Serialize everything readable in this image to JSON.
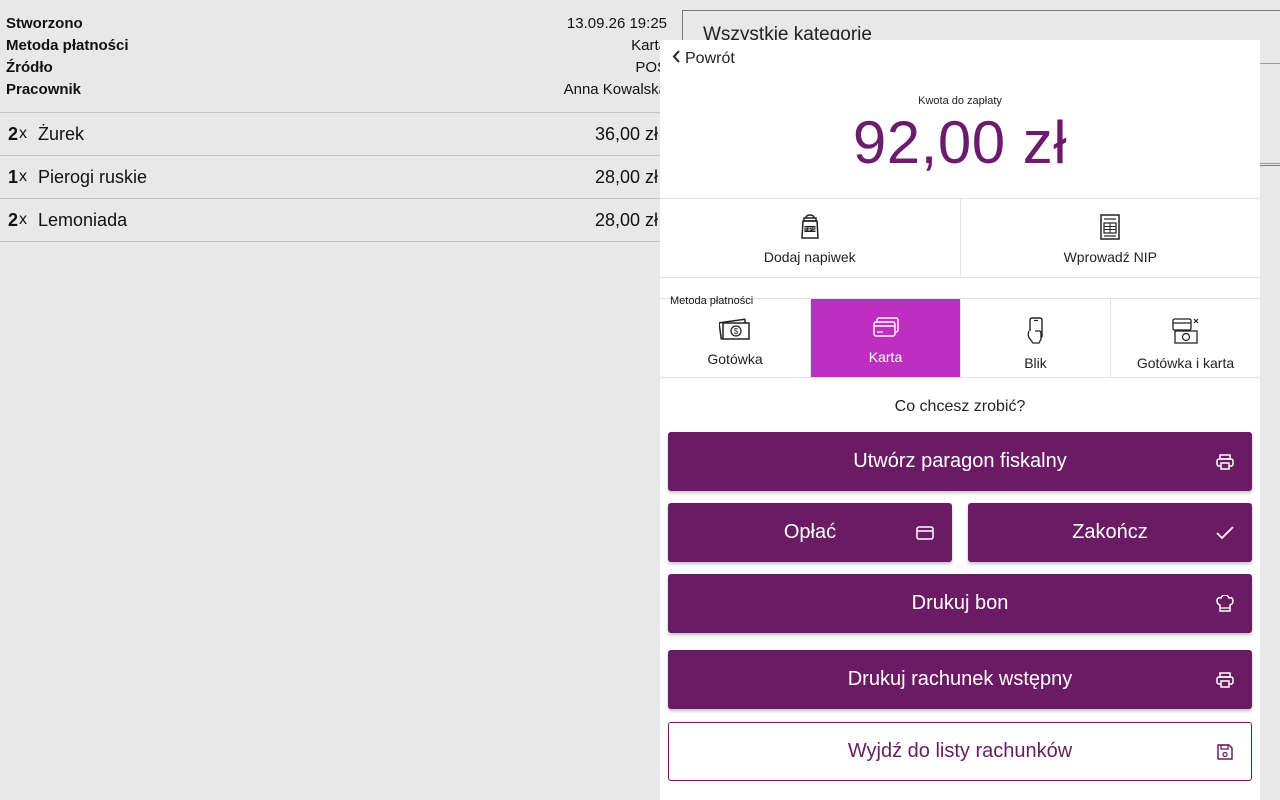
{
  "order": {
    "meta": [
      {
        "label": "Stworzono",
        "value": "13.09.26 19:25"
      },
      {
        "label": "Metoda płatności",
        "value": "Karta"
      },
      {
        "label": "Źródło",
        "value": "POS"
      },
      {
        "label": "Pracownik",
        "value": "Anna Kowalska"
      }
    ],
    "items": [
      {
        "qty": "2",
        "x": "x",
        "name": "Żurek",
        "price": "36,00 zł"
      },
      {
        "qty": "1",
        "x": "x",
        "name": "Pierogi ruskie",
        "price": "28,00 zł"
      },
      {
        "qty": "2",
        "x": "x",
        "name": "Lemoniada",
        "price": "28,00 zł"
      }
    ]
  },
  "categories": {
    "title": "Wszystkie kategorie"
  },
  "modal": {
    "back_label": "Powrót",
    "amount_label": "Kwota do zapłaty",
    "amount": "92,00 zł",
    "actions": [
      {
        "label": "Dodaj napiwek",
        "icon": "tips-jar-icon"
      },
      {
        "label": "Wprowadź NIP",
        "icon": "invoice-icon"
      }
    ],
    "payment_method_label": "Metoda płatności",
    "payment_methods": [
      {
        "label": "Gotówka",
        "icon": "cash-icon",
        "active": false
      },
      {
        "label": "Karta",
        "icon": "card-icon",
        "active": true
      },
      {
        "label": "Blik",
        "icon": "phone-icon",
        "active": false
      },
      {
        "label": "Gotówka i karta",
        "icon": "cash-and-card-icon",
        "active": false
      }
    ],
    "question": "Co chcesz zrobić?",
    "buttons": {
      "fiscal_receipt": "Utwórz paragon fiskalny",
      "pay": "Opłać",
      "finish": "Zakończ",
      "print_ticket": "Drukuj bon",
      "print_prebill": "Drukuj rachunek wstępny",
      "exit_to_list": "Wyjdź do listy rachunków"
    }
  },
  "colors": {
    "accent": "#6a1b63",
    "active_method": "#bf2fbf",
    "amount": "#6d1b6d"
  }
}
